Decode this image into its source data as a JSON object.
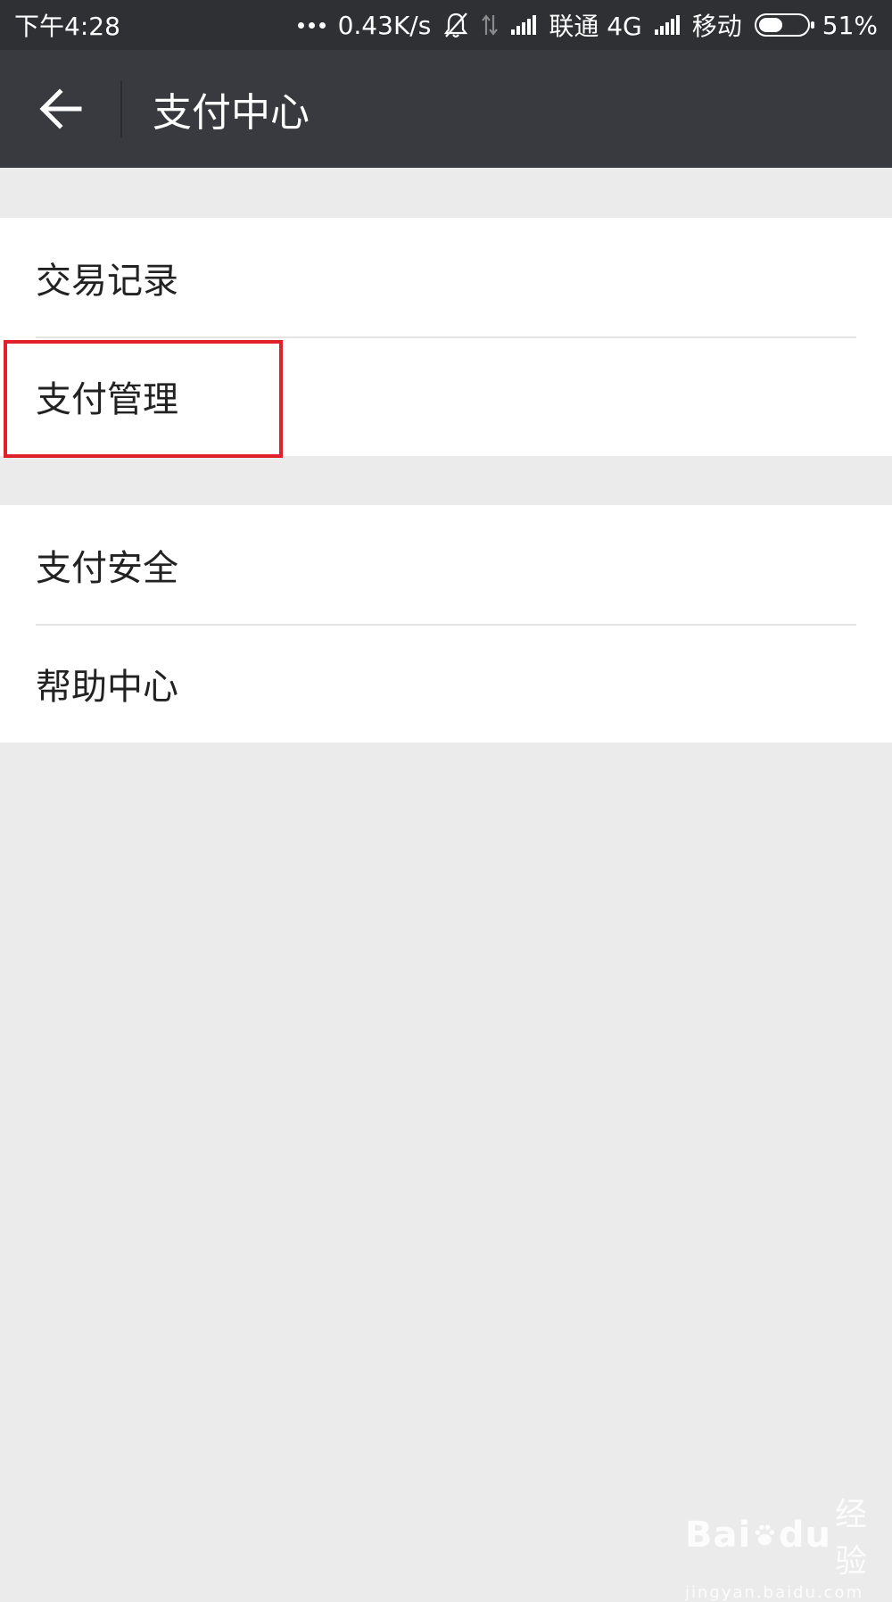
{
  "status_bar": {
    "time": "下午4:28",
    "net_speed": "0.43K/s",
    "carrier1": "联通 4G",
    "carrier2": "移动",
    "battery_text": "51%",
    "battery_level": 0.51,
    "icons": [
      "more-dots-icon",
      "mute-bell-icon",
      "data-arrows-icon",
      "signal-icon",
      "battery-icon"
    ]
  },
  "header": {
    "title": "支付中心",
    "back_icon": "back-arrow-icon"
  },
  "menu_groups": [
    {
      "items": [
        {
          "label": "交易记录"
        },
        {
          "label": "支付管理"
        }
      ]
    },
    {
      "items": [
        {
          "label": "支付安全"
        },
        {
          "label": "帮助中心"
        }
      ]
    }
  ],
  "watermark": {
    "brand": "Bai",
    "brand_tail": "du",
    "brand_cn": "经验",
    "sub": "jingyan.baidu.com"
  },
  "colors": {
    "status_bg": "#2f3034",
    "header_bg": "#393a3f",
    "page_bg": "#ebebeb",
    "highlight": "#e0202a"
  }
}
